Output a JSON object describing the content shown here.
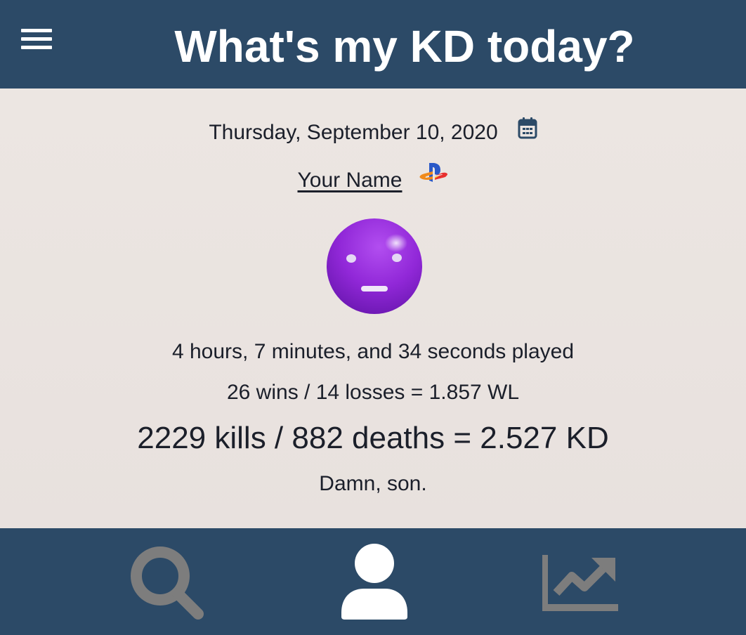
{
  "header": {
    "title": "What's my KD today?",
    "menu_icon": "hamburger-menu-icon"
  },
  "session": {
    "date": "Thursday, September 10, 2020",
    "calendar_icon": "calendar-icon",
    "player_name": "Your Name",
    "platform_icon": "playstation-icon",
    "mood_icon": "neutral-face-emoji",
    "time_played": "4 hours, 7 minutes, and 34 seconds played",
    "wl_summary": "26 wins / 14 losses = 1.857 WL",
    "kd_summary": "2229 kills / 882 deaths = 2.527 KD",
    "verdict": "Damn, son."
  },
  "stats": {
    "hours": 4,
    "minutes": 7,
    "seconds": 34,
    "wins": 26,
    "losses": 14,
    "wl": 1.857,
    "kills": 2229,
    "deaths": 882,
    "kd": 2.527
  },
  "nav": {
    "items": [
      {
        "icon": "search-icon",
        "active": false
      },
      {
        "icon": "user-icon",
        "active": true
      },
      {
        "icon": "chart-line-icon",
        "active": false
      }
    ]
  },
  "colors": {
    "bar_background": "#2c4a67",
    "content_background": "#ebe5e2",
    "text": "#1b1f2a",
    "nav_active": "#ffffff",
    "nav_inactive": "#7d7d7d",
    "emoji_purple": "#8e2bd6"
  }
}
